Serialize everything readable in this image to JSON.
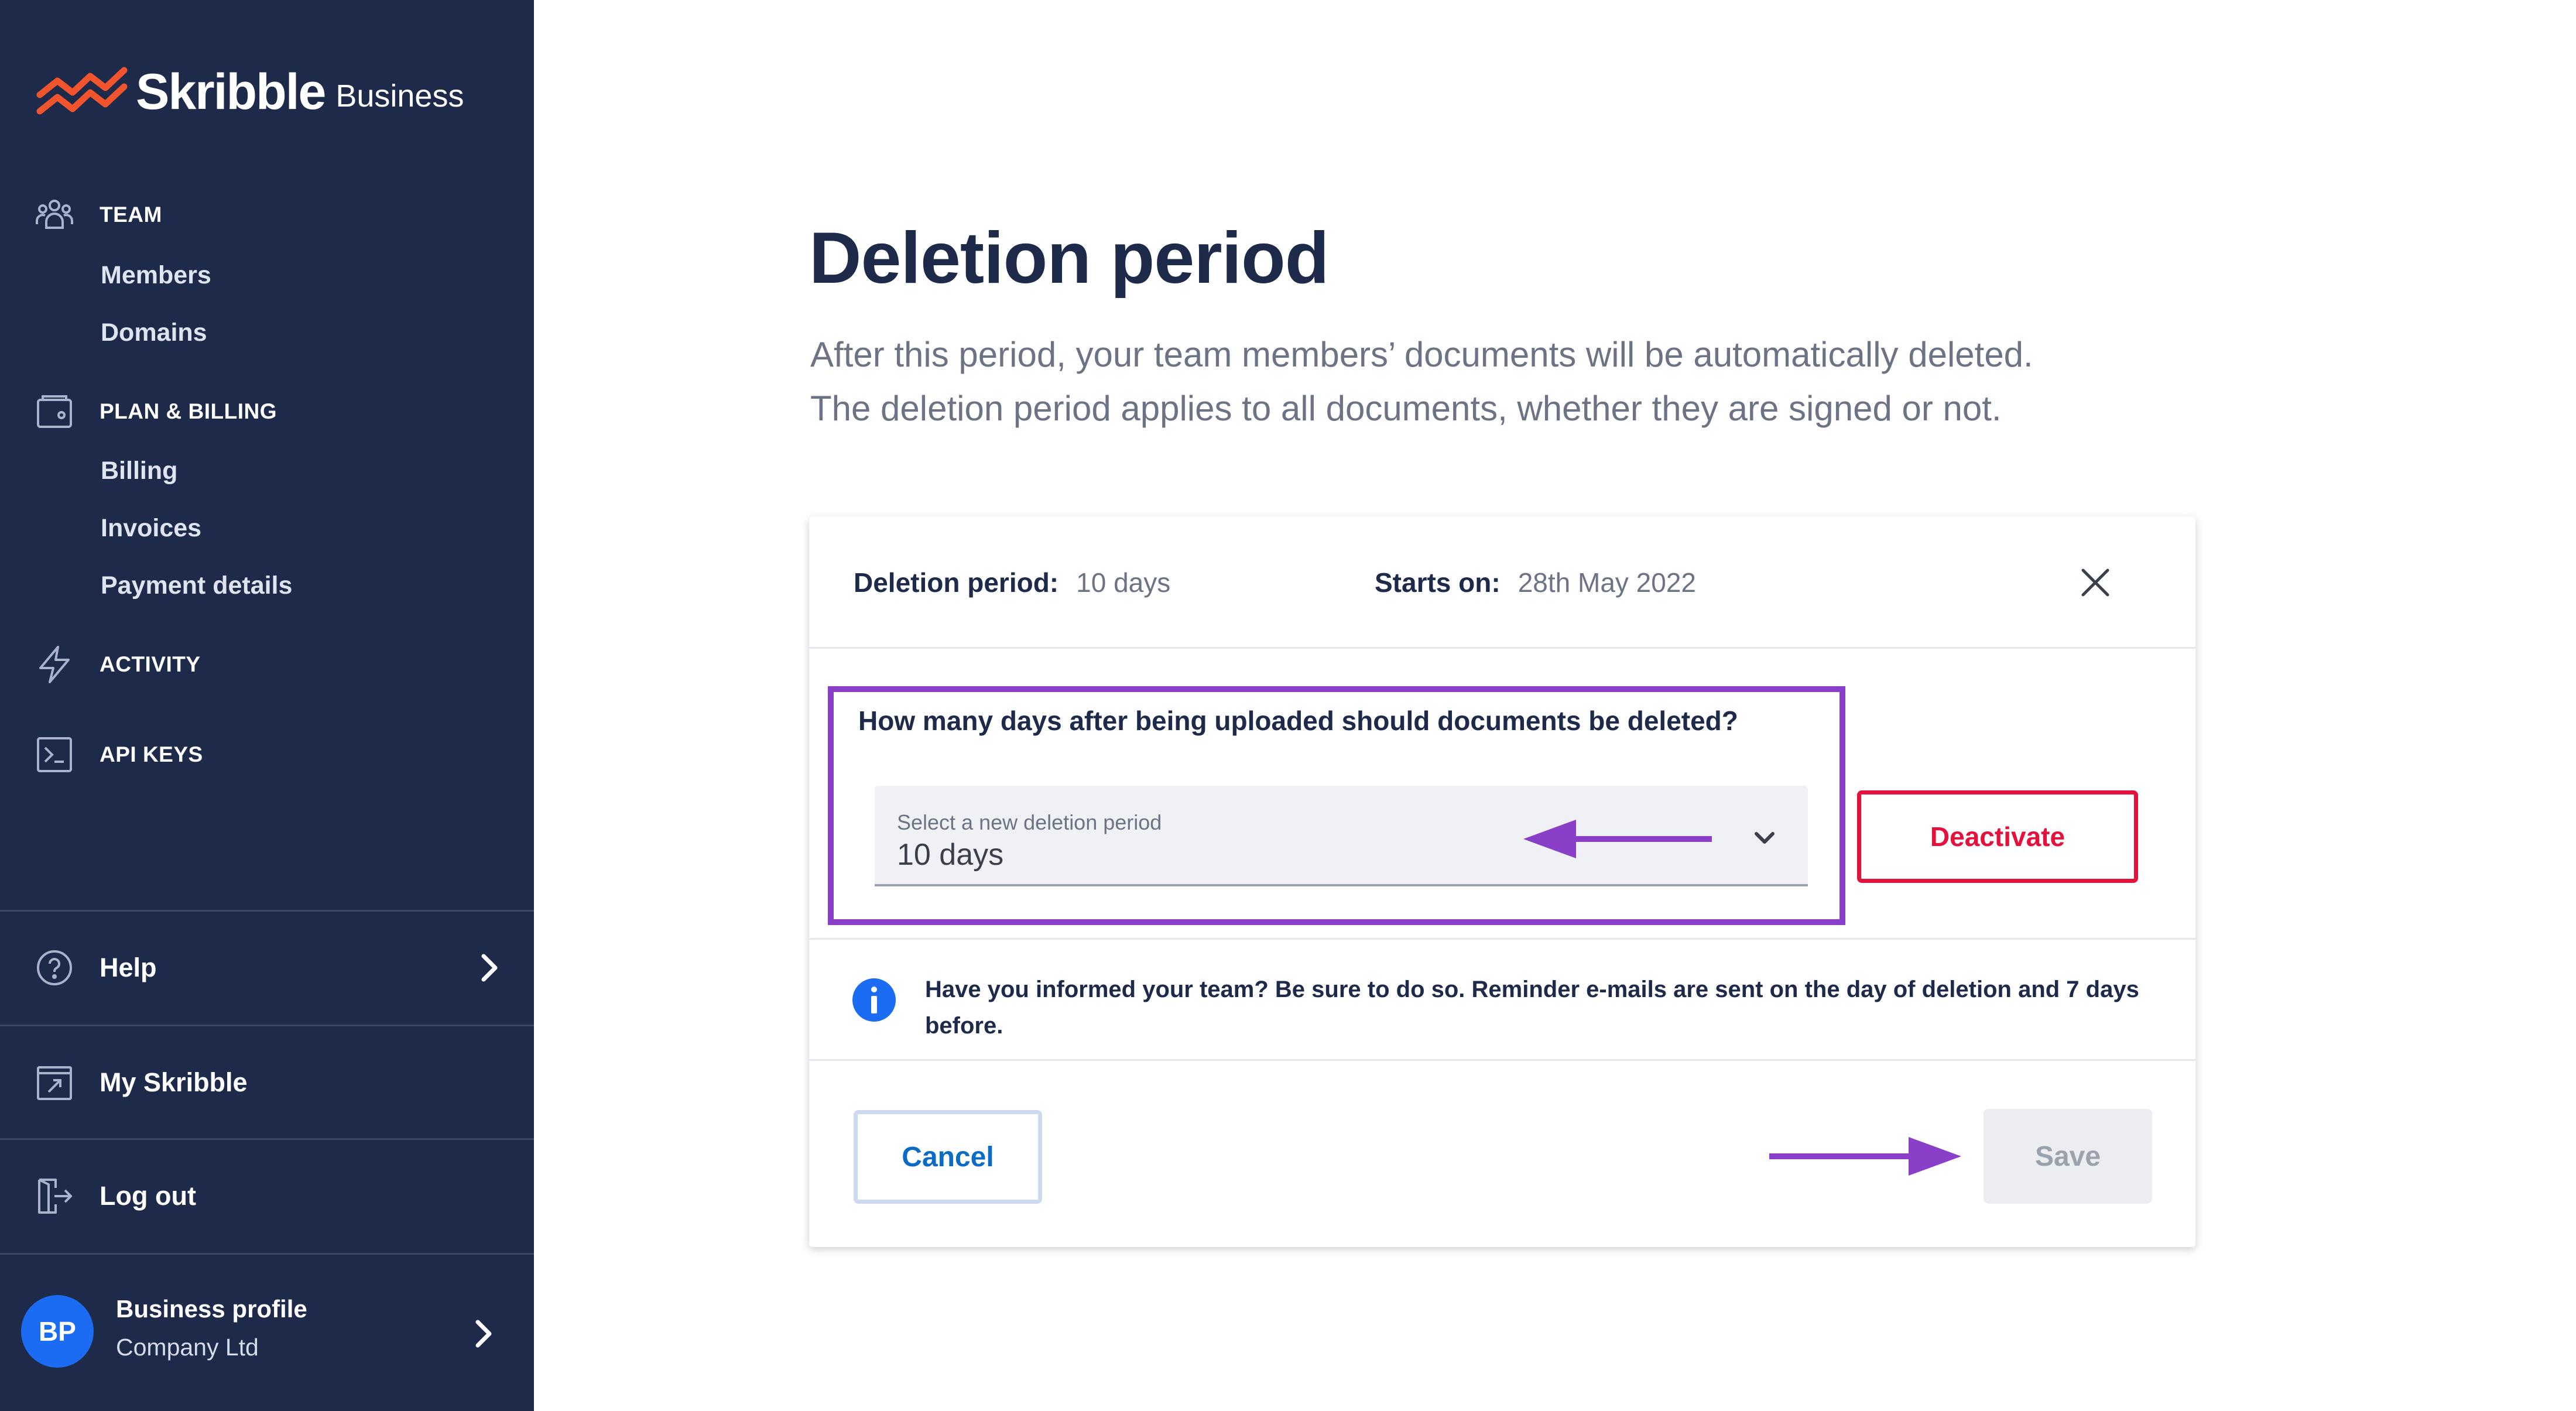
{
  "brand": {
    "name": "Skribble",
    "suffix": "Business",
    "accent_color": "#f2542d"
  },
  "sidebar": {
    "background_color": "#1e2a4a",
    "sections": [
      {
        "heading": "TEAM",
        "icon": "team-icon",
        "items": [
          "Members",
          "Domains"
        ]
      },
      {
        "heading": "PLAN & BILLING",
        "icon": "wallet-icon",
        "items": [
          "Billing",
          "Invoices",
          "Payment details"
        ]
      },
      {
        "heading": "ACTIVITY",
        "icon": "lightning-icon",
        "items": []
      },
      {
        "heading": "API KEYS",
        "icon": "terminal-icon",
        "items": []
      }
    ],
    "bottom": [
      {
        "label": "Help",
        "icon": "help-circle-icon"
      },
      {
        "label": "My Skribble",
        "icon": "external-link-icon"
      },
      {
        "label": "Log out",
        "icon": "logout-icon"
      }
    ],
    "profile": {
      "initials": "BP",
      "name": "Business profile",
      "company": "Company Ltd"
    }
  },
  "main": {
    "title": "Deletion period",
    "description": [
      "After this period, your team members’ documents will be automatically deleted.",
      "The deletion period applies to all documents, whether they are signed or not."
    ],
    "card": {
      "period_key": "Deletion period:",
      "period_value": "10 days",
      "starts_key": "Starts on:",
      "starts_value": "28th May 2022",
      "question": "How many days after being uploaded should documents be deleted?",
      "select": {
        "label": "Select a new deletion period",
        "value": "10 days"
      },
      "deactivate_label": "Deactivate",
      "info_text": "Have you informed your team? Be sure to do so. Reminder e-mails are sent on the day of deletion and 7 days before.",
      "cancel_label": "Cancel",
      "save_label": "Save"
    },
    "highlight_color": "#8a3fc9",
    "danger_color": "#e3113b",
    "link_color": "#0a6cc4"
  }
}
